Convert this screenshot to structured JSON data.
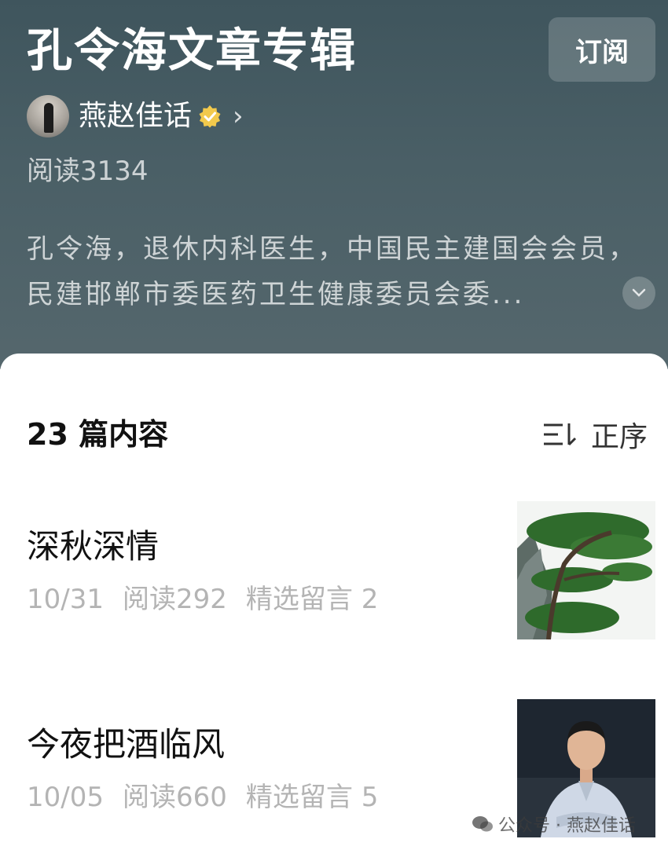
{
  "header": {
    "title": "孔令海文章专辑",
    "subscribe_label": "订阅",
    "author_name": "燕赵佳话",
    "read_count": "阅读3134",
    "description": "孔令海，退休内科医生，中国民主建国会会员，民建邯郸市委医药卫生健康委员会委..."
  },
  "list": {
    "count_label": "23 篇内容",
    "sort_label": "正序",
    "articles": [
      {
        "title": "深秋深情",
        "date": "10/31",
        "reads": "阅读292",
        "comments": "精选留言 2",
        "thumbnail": "pine-tree-image"
      },
      {
        "title": "今夜把酒临风",
        "date": "10/05",
        "reads": "阅读660",
        "comments": "精选留言 5",
        "thumbnail": "man-portrait-image"
      }
    ]
  },
  "watermark": {
    "text": "公众号 · 燕赵佳话"
  },
  "colors": {
    "header_bg": "#4a5f66",
    "verified_badge": "#f2c94c",
    "meta_text": "#b4b4b4"
  }
}
